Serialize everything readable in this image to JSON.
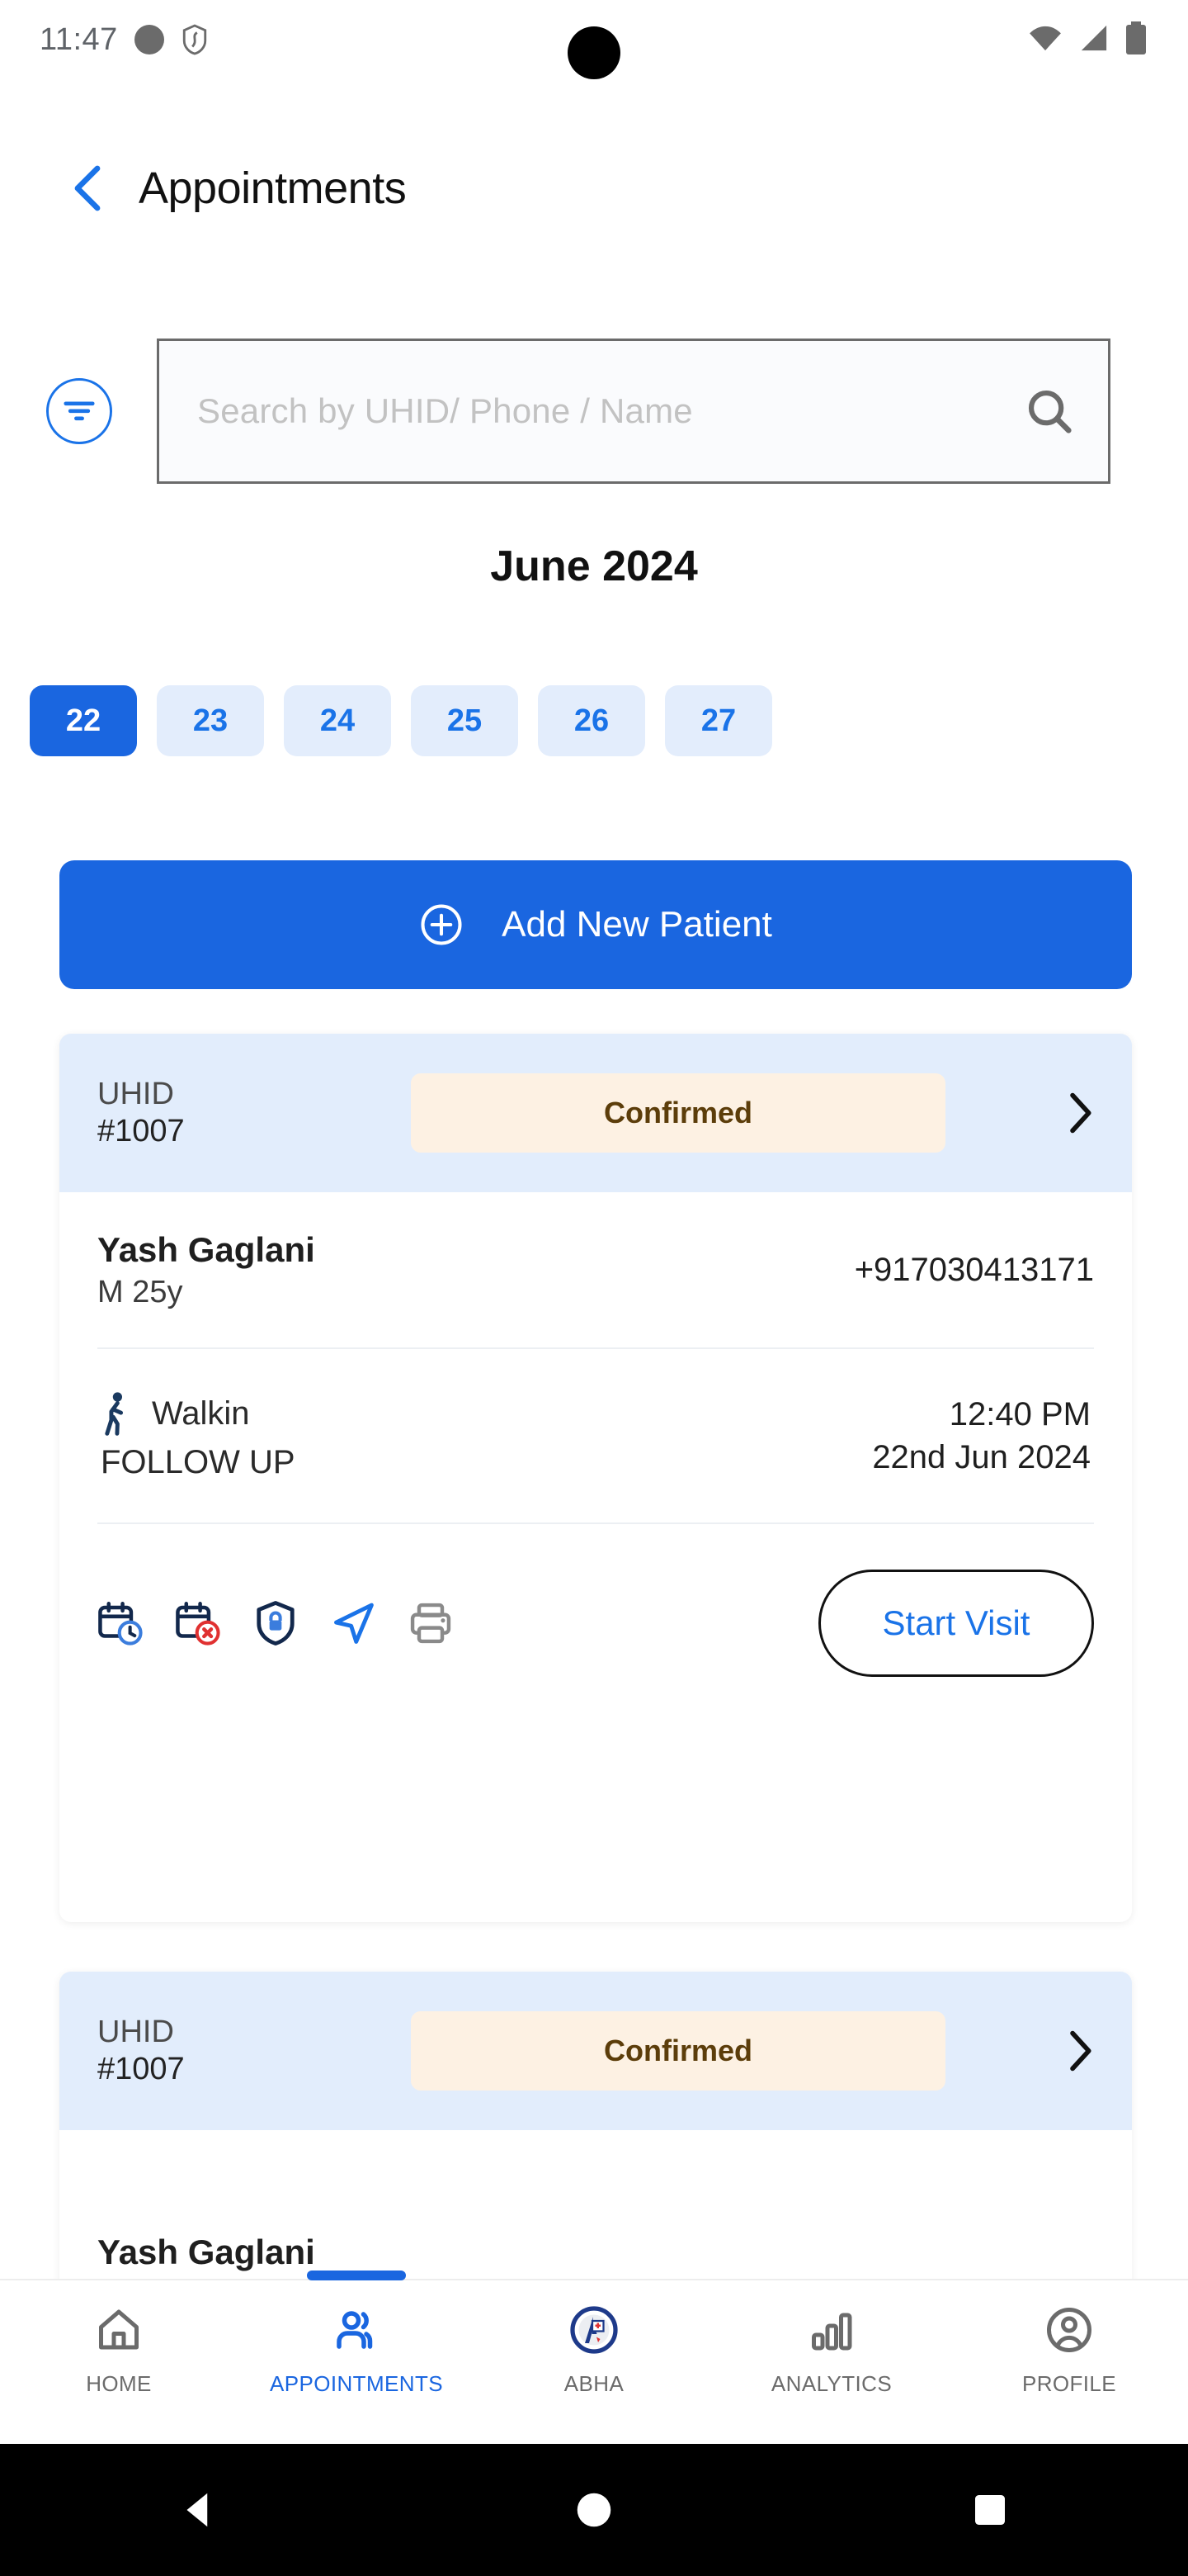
{
  "status_bar": {
    "time": "11:47",
    "left_icons": [
      "record-dot-icon",
      "shield-icon"
    ],
    "right_icons": [
      "wifi-icon",
      "cellular-signal-icon",
      "battery-icon"
    ]
  },
  "app_bar": {
    "back_label": "back-icon",
    "title": "Appointments"
  },
  "search": {
    "filter_icon": "filter-icon",
    "placeholder": "Search by UHID/ Phone / Name",
    "value": "",
    "search_icon": "search-icon"
  },
  "calendar": {
    "month_title": "June 2024",
    "selected_date": "22",
    "dates": [
      "22",
      "23",
      "24",
      "25",
      "26",
      "27"
    ]
  },
  "add_patient": {
    "label": "Add New Patient",
    "icon": "plus-circle-icon"
  },
  "appointments": [
    {
      "uhid_label": "UHID",
      "uhid_value": "#1007",
      "status": "Confirmed",
      "status_color": "#5c3d0a",
      "status_bg": "#fdf1e3",
      "patient_name": "Yash Gaglani",
      "patient_meta": "M 25y",
      "phone": "+917030413171",
      "visit_type": "Walkin",
      "visit_kind": "FOLLOW UP",
      "time": "12:40 PM",
      "date": "22nd Jun 2024",
      "actions": [
        "reschedule-calendar-clock-icon",
        "cancel-calendar-x-icon",
        "shield-lock-icon",
        "send-share-icon",
        "print-icon"
      ],
      "primary_action": "Start Visit"
    },
    {
      "uhid_label": "UHID",
      "uhid_value": "#1007",
      "status": "Confirmed",
      "status_color": "#5c3d0a",
      "status_bg": "#fdf1e3",
      "patient_name": "Yash Gaglani"
    }
  ],
  "bottom_nav": {
    "active": "APPOINTMENTS",
    "items": [
      {
        "label": "HOME",
        "icon": "home-icon"
      },
      {
        "label": "APPOINTMENTS",
        "icon": "people-icon"
      },
      {
        "label": "ABHA",
        "icon": "abha-logo-icon"
      },
      {
        "label": "ANALYTICS",
        "icon": "bar-chart-icon"
      },
      {
        "label": "PROFILE",
        "icon": "person-circle-icon"
      }
    ]
  },
  "system_nav": {
    "back": "android-back-icon",
    "home": "android-home-icon",
    "recents": "android-recents-icon"
  },
  "theme": {
    "accent": "#1a66e0",
    "link": "#1a73e8",
    "card_header_bg": "#e2edfc",
    "chip_bg": "#e3edfc"
  }
}
